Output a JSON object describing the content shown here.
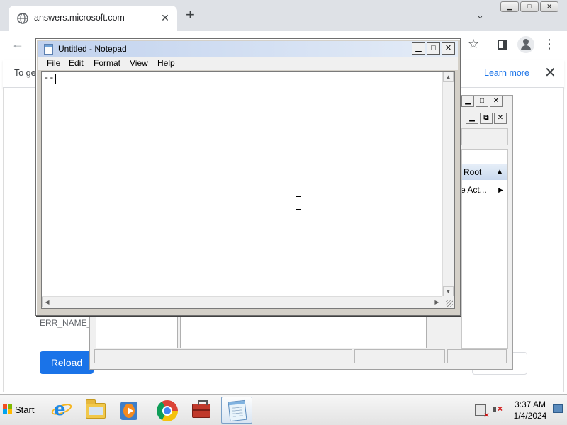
{
  "browser": {
    "tab_title": "answers.microsoft.com",
    "tab_close": "✕",
    "new_tab": "+",
    "tab_search": "⌄",
    "window_buttons": {
      "minimize": "▁",
      "maximize": "□",
      "close": "✕"
    },
    "back": "←",
    "bookmark": "☆",
    "menu": "⋮",
    "infobar": {
      "text": "To ge",
      "learn_more": "Learn more",
      "close": "✕"
    },
    "error_code": "ERR_NAME_N",
    "reload_label": "Reload"
  },
  "background_window": {
    "buttons_row1": [
      "▁",
      "□",
      "✕"
    ],
    "buttons_row2": [
      "▁",
      "⧉",
      "✕"
    ],
    "header_text": "e Root",
    "header_arrow": "▲",
    "row_text": "re Act...",
    "row_arrow": "▶"
  },
  "notepad": {
    "title": "Untitled - Notepad",
    "controls": {
      "minimize": "▁",
      "maximize": "□",
      "close": "✕"
    },
    "menu": [
      "File",
      "Edit",
      "Format",
      "View",
      "Help"
    ],
    "text": "--",
    "scroll_arrows": {
      "up": "▲",
      "down": "▼",
      "left": "◀",
      "right": "▶"
    }
  },
  "taskbar": {
    "start_label": "Start",
    "items": [
      "internet-explorer",
      "windows-explorer",
      "media-player",
      "google-chrome",
      "toolbox",
      "notepad"
    ],
    "active_item": "notepad",
    "clock": {
      "time": "3:37 AM",
      "date": "1/4/2024"
    }
  },
  "colors": {
    "chrome_tabbar": "#dee1e6",
    "reload_button": "#1a73e8",
    "notepad_title_gradient": [
      "#c1d2ee",
      "#e4ecf7"
    ],
    "taskbar": "#e3e3e3"
  }
}
